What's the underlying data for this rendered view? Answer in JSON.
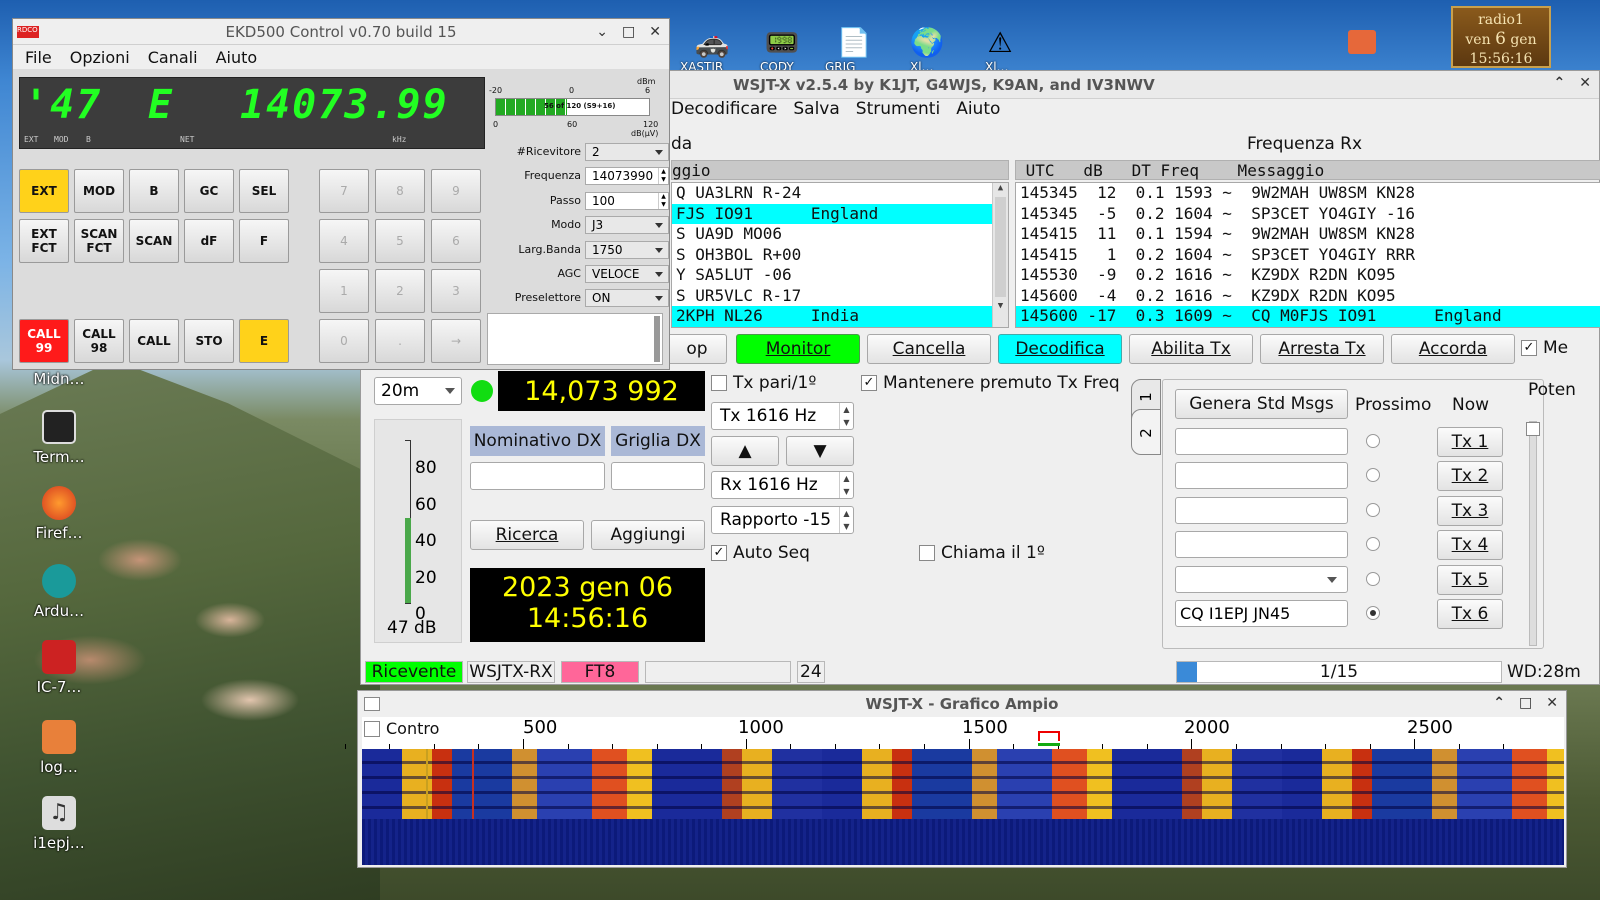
{
  "desktop": {
    "icons": [
      "Midn…",
      "Term…",
      "Firef…",
      "Ardu…",
      "IC-7…",
      "log…",
      "i1epj…"
    ],
    "top_icons": [
      "XASTIR",
      "CODY",
      "GRIG",
      "Xl…",
      "Xl…"
    ],
    "clock": {
      "name": "radio1",
      "day": "ven",
      "date_num": "6",
      "month": "gen",
      "time": "15:56:16"
    }
  },
  "wsjtx": {
    "title": "WSJT-X   v2.5.4   by K1JT, G4WJS, K9AN, and IV3NWV",
    "menu": [
      "Decodificare",
      "Salva",
      "Strumenti",
      "Aiuto"
    ],
    "left_header_label": "da",
    "right_header_label": "Frequenza Rx",
    "left_col_header": "ggio",
    "right_col_header": " UTC   dB   DT Freq    Messaggio",
    "left_rows": [
      {
        "text": "Q UA3LRN R-24",
        "hl": false
      },
      {
        "text": "FJS IO91      England",
        "hl": true
      },
      {
        "text": "S UA9D MO06",
        "hl": false
      },
      {
        "text": "S OH3BOL R+00",
        "hl": false
      },
      {
        "text": "Y SA5LUT -06",
        "hl": false
      },
      {
        "text": "S UR5VLC R-17",
        "hl": false
      },
      {
        "text": "2KPH NL26     India",
        "hl": true
      }
    ],
    "right_rows": [
      {
        "text": "145345  12  0.1 1593 ~  9W2MAH UW8SM KN28",
        "hl": false
      },
      {
        "text": "145345  -5  0.2 1604 ~  SP3CET YO4GIY -16",
        "hl": false
      },
      {
        "text": "145415  11  0.1 1594 ~  9W2MAH UW8SM KN28",
        "hl": false
      },
      {
        "text": "145415   1  0.2 1604 ~  SP3CET YO4GIY RRR",
        "hl": false
      },
      {
        "text": "145530  -9  0.2 1616 ~  KZ9DX R2DN KO95",
        "hl": false
      },
      {
        "text": "145600  -4  0.2 1616 ~  KZ9DX R2DN KO95",
        "hl": false
      },
      {
        "text": "145600 -17  0.3 1609 ~  CQ M0FJS IO91      England",
        "hl": true
      }
    ],
    "buttons": {
      "stop": "op",
      "monitor": "Monitor",
      "erase": "Cancella",
      "decode": "Decodifica",
      "enable_tx": "Abilita Tx",
      "halt_tx": "Arresta Tx",
      "tune": "Accorda",
      "menu_chk": "Me"
    },
    "band": "20m",
    "dial_freq": "14,073 992",
    "tx_even": "Tx pari/1º",
    "hold_tx": "Mantenere premuto Tx Freq",
    "tx_freq": "Tx  1616  Hz",
    "rx_freq": "Rx  1616  Hz",
    "report": "Rapporto -15",
    "up_arrow": "▲",
    "down_arrow": "▼",
    "auto_seq": "Auto Seq",
    "call_first": "Chiama il 1º",
    "dx_call_label": "Nominativo DX",
    "dx_grid_label": "Griglia DX",
    "lookup": "Ricerca",
    "add": "Aggiungi",
    "date": "2023 gen 06",
    "time": "14:56:16",
    "meter_ticks": [
      "80",
      "60",
      "40",
      "20",
      "0"
    ],
    "meter_level_db": 47,
    "meter_value": "47 dB",
    "tab1": "1",
    "tab2": "2",
    "gen_std": "Genera Std Msgs",
    "next_label": "Prossimo",
    "now_label": "Now",
    "tx_messages": [
      "",
      "",
      "",
      "",
      "",
      "CQ I1EPJ JN45"
    ],
    "tx_buttons": [
      "Tx 1",
      "Tx 2",
      "Tx 3",
      "Tx 4",
      "Tx 5",
      "Tx 6"
    ],
    "selected_tx": 6,
    "power_label": "Poten",
    "status": {
      "state": "Ricevente",
      "config": "WSJTX-RX",
      "mode": "FT8",
      "number": "24",
      "progress": "1/15",
      "wd": "WD:28m"
    },
    "colors": {
      "green": "#00ff00",
      "cyan": "#00ffff",
      "pink": "#ff6699",
      "yellow": "#ffff00"
    }
  },
  "wide_graph": {
    "title": "WSJT-X - Grafico Ampio",
    "control_label": "Contro",
    "scale_labels": [
      "500",
      "1000",
      "1500",
      "2000",
      "2500"
    ]
  },
  "ekd": {
    "title": "EKD500 Control v0.70 build 15",
    "app_badge": "RDCO",
    "menu": [
      "File",
      "Opzioni",
      "Canali",
      "Aiuto"
    ],
    "lcd_channel": "'47",
    "lcd_mode": "E",
    "lcd_freq": "14073.99",
    "lcd_sub": [
      "EXT",
      "MOD",
      "B",
      "NET",
      "kHz"
    ],
    "smeter_top": [
      "-20",
      "0",
      "6",
      "dBm"
    ],
    "smeter_bottom": [
      "0",
      "60",
      "120",
      "dB(µV)"
    ],
    "smeter_text": "56 of 120 (S9+16)",
    "smeter_level": 56,
    "smeter_max": 120,
    "fields": [
      {
        "label": "#Ricevitore",
        "value": "2",
        "type": "combo"
      },
      {
        "label": "Frequenza",
        "value": "14073990",
        "type": "spin"
      },
      {
        "label": "Passo",
        "value": "100",
        "type": "spin"
      },
      {
        "label": "Modo",
        "value": "J3",
        "type": "combo"
      },
      {
        "label": "Larg.Banda",
        "value": "1750",
        "type": "combo"
      },
      {
        "label": "AGC",
        "value": "VELOCE",
        "type": "combo"
      },
      {
        "label": "Preselettore",
        "value": "ON",
        "type": "combo"
      }
    ],
    "func_buttons": [
      [
        "EXT",
        "MOD",
        "B",
        "GC",
        "SEL"
      ],
      [
        "EXT FCT",
        "SCAN FCT",
        "SCAN",
        "dF",
        "F"
      ],
      [
        "CALL 99",
        "CALL 98",
        "CALL",
        "STO",
        "E"
      ]
    ],
    "keypad": [
      [
        "7",
        "8",
        "9"
      ],
      [
        "4",
        "5",
        "6"
      ],
      [
        "1",
        "2",
        "3"
      ],
      [
        "0",
        ".",
        "→"
      ]
    ]
  }
}
